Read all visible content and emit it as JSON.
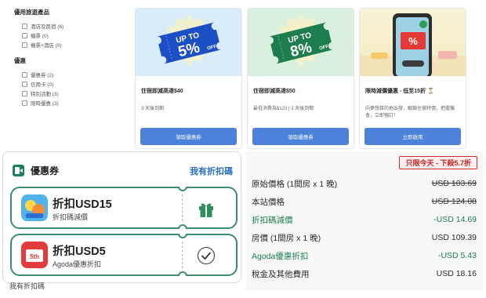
{
  "filters": {
    "section1_title": "優用旅遊產品",
    "section1_items": [
      "酒店及民宿 (6)",
      "機票 (0)",
      "機票+酒店 (0)"
    ],
    "section2_title": "優惠",
    "section2_items": [
      "優惠券 (2)",
      "信用卡 (0)",
      "特別活動 (3)",
      "限時優惠 (3)"
    ]
  },
  "promo_cards": [
    {
      "ticket_line1": "UP TO",
      "ticket_big": "5%",
      "ticket_small": "OFF",
      "title": "住宿即減高達$40",
      "subtitle": "3 天後到期",
      "button": "領取優惠券",
      "color": "#1d4fc4"
    },
    {
      "ticket_line1": "UP TO",
      "ticket_big": "8%",
      "ticket_small": "OFF",
      "title": "住宿即減高達$50",
      "subtitle": "最低消費為$120 | 3 天後到期",
      "button": "領取優惠券",
      "color": "#1e7d4e"
    },
    {
      "phone_symbol": "%",
      "title": "限時減價優惠 - 低至15折 ⏳",
      "subtitle": "向夢想目的地出發，解鎖住宿特價，把握機會，立即預訂！",
      "button": "立即啟用"
    }
  ],
  "coupon_panel": {
    "title": "優惠券",
    "link": "我有折扣碼",
    "coupons": [
      {
        "main": "折扣USD15",
        "sub": "折扣碼減價",
        "side_icon": "gift-icon"
      },
      {
        "main": "折扣USD5",
        "sub": "Agoda優惠折扣",
        "logo_text": "5th",
        "side_icon": "check-icon"
      }
    ],
    "footer_link": "我有折扣碼"
  },
  "price_panel": {
    "badge": "只限今天 - 下殺5.7折",
    "rows": [
      {
        "label": "原始價格 (1間房 x 1 晚)",
        "value": "USD 103.69"
      },
      {
        "label": "本站價格",
        "value": "USD 124.08"
      },
      {
        "label": "折扣碼減價",
        "value": "-USD 14.69"
      },
      {
        "label": "房價 (1間房 x 1 晚)",
        "value": "USD 109.39"
      },
      {
        "label": "Agoda優惠折扣",
        "value": "-USD 5.43"
      },
      {
        "label": "稅金及其他費用",
        "value": "USD 18.16"
      }
    ]
  },
  "colors": {
    "accent": "#4c82d9",
    "green": "#1a7f4c",
    "ticket_border": "#3a8f6a",
    "badge_red": "#d42a2a",
    "link_blue": "#2a6cc7"
  }
}
